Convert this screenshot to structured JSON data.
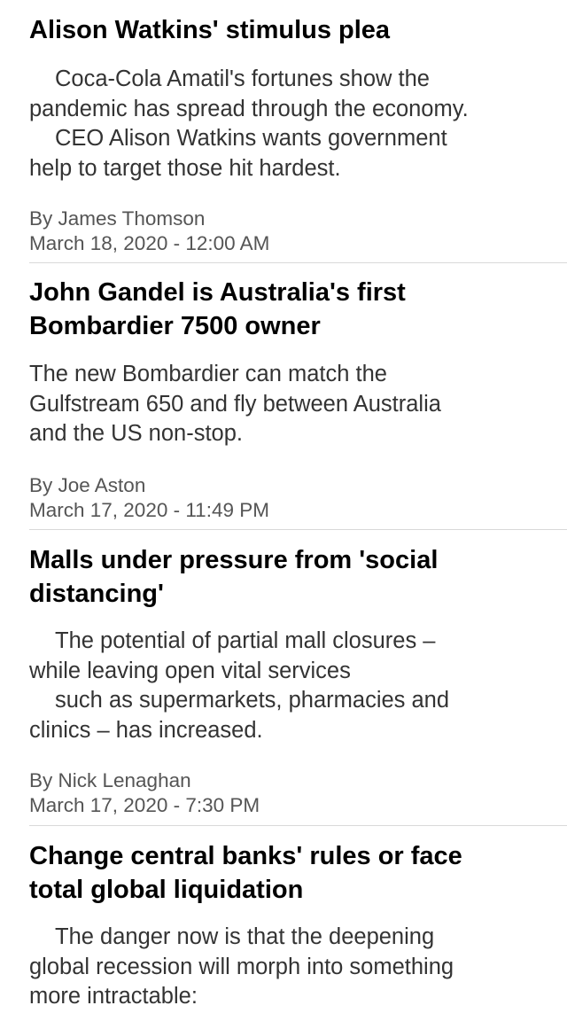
{
  "articles": [
    {
      "headline_lines": [
        "Alison Watkins' stimulus plea"
      ],
      "summary_lines": [
        {
          "text": "Coca-Cola Amatil's fortunes show the",
          "indent": true
        },
        {
          "text": "pandemic has spread through the economy.",
          "indent": false
        },
        {
          "text": "CEO Alison Watkins wants government",
          "indent": true
        },
        {
          "text": "help to target those hit hardest.",
          "indent": false
        }
      ],
      "byline": "By James Thomson",
      "date": "March 18, 2020 - 12:00 AM"
    },
    {
      "headline_lines": [
        "John Gandel is Australia's first",
        "Bombardier 7500 owner"
      ],
      "summary_lines": [
        {
          "text": "The new Bombardier can match the",
          "indent": false
        },
        {
          "text": "Gulfstream 650 and fly between Australia",
          "indent": false
        },
        {
          "text": "and the US non-stop.",
          "indent": false
        }
      ],
      "byline": "By Joe Aston",
      "date": "March 17, 2020 - 11:49 PM"
    },
    {
      "headline_lines": [
        "Malls under pressure from 'social",
        "distancing'"
      ],
      "summary_lines": [
        {
          "text": "The potential of partial mall closures –",
          "indent": true
        },
        {
          "text": "while leaving open vital services",
          "indent": false
        },
        {
          "text": "such as supermarkets, pharmacies and",
          "indent": true
        },
        {
          "text": "clinics – has increased.",
          "indent": false
        }
      ],
      "byline": "By Nick Lenaghan",
      "date": "March 17, 2020 - 7:30 PM"
    },
    {
      "headline_lines": [
        "Change central banks' rules or face",
        "total global liquidation"
      ],
      "summary_lines": [
        {
          "text": "The danger now is that the deepening",
          "indent": true
        },
        {
          "text": "global recession will morph into something",
          "indent": false
        },
        {
          "text": "more intractable:",
          "indent": false
        }
      ],
      "byline": "",
      "date": ""
    }
  ]
}
